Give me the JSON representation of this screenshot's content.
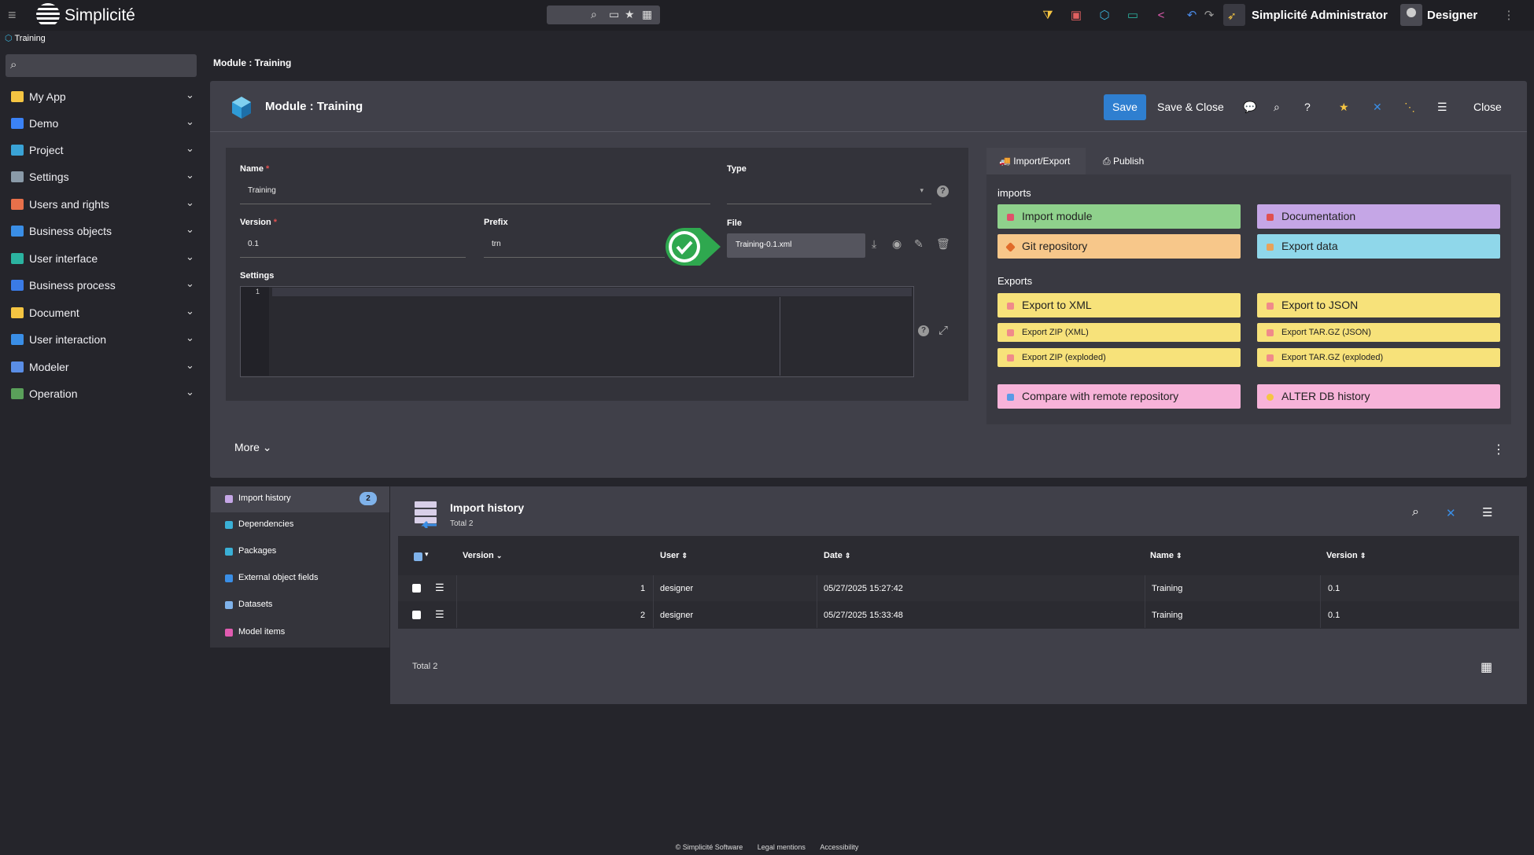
{
  "app": {
    "brand": "Simplicité"
  },
  "topbar": {
    "admin_label": "Simplicité Administrator",
    "user_label": "Designer"
  },
  "breadcrumb": {
    "label": "Training"
  },
  "sidebar": {
    "items": [
      {
        "label": "My App",
        "icon": "folder-icon",
        "color": "#f5c542"
      },
      {
        "label": "Demo",
        "icon": "demo-icon",
        "color": "#3b82f6"
      },
      {
        "label": "Project",
        "icon": "cube-icon",
        "color": "#3aa3d6"
      },
      {
        "label": "Settings",
        "icon": "gear-icon",
        "color": "#8a9aa8"
      },
      {
        "label": "Users and rights",
        "icon": "users-icon",
        "color": "#e8704a"
      },
      {
        "label": "Business objects",
        "icon": "tools-icon",
        "color": "#3a8ee6"
      },
      {
        "label": "User interface",
        "icon": "monitor-icon",
        "color": "#2bb3a0"
      },
      {
        "label": "Business process",
        "icon": "process-icon",
        "color": "#3a7be6"
      },
      {
        "label": "Document",
        "icon": "folder-icon",
        "color": "#f5c542"
      },
      {
        "label": "User interaction",
        "icon": "chat-icon",
        "color": "#3a8ee6"
      },
      {
        "label": "Modeler",
        "icon": "hierarchy-icon",
        "color": "#5a8ee6"
      },
      {
        "label": "Operation",
        "icon": "pulse-icon",
        "color": "#5aa05a"
      }
    ]
  },
  "page": {
    "title": "Module : Training"
  },
  "form": {
    "title": "Module : Training",
    "buttons": {
      "save": "Save",
      "save_close": "Save & Close",
      "close": "Close"
    },
    "fields": {
      "name_label": "Name",
      "name_value": "Training",
      "type_label": "Type",
      "version_label": "Version",
      "version_value": "0.1",
      "prefix_label": "Prefix",
      "prefix_value": "trn",
      "file_label": "File",
      "file_value": "Training-0.1.xml",
      "settings_label": "Settings",
      "editor_line": "1"
    },
    "more_label": "More"
  },
  "tabs": {
    "import_export": "Import/Export",
    "publish": "Publish"
  },
  "actions": {
    "imports_title": "imports",
    "exports_title": "Exports",
    "import_module": "Import module",
    "documentation": "Documentation",
    "git_repository": "Git repository",
    "export_data": "Export data",
    "export_xml": "Export to XML",
    "export_json": "Export to JSON",
    "export_zip_xml": "Export ZIP (XML)",
    "export_targz_json": "Export TAR.GZ (JSON)",
    "export_zip_exploded": "Export ZIP (exploded)",
    "export_targz_exploded": "Export TAR.GZ (exploded)",
    "compare_remote": "Compare with remote repository",
    "alter_db_history": "ALTER DB history",
    "colors": {
      "green": "#8fd18c",
      "purple": "#c5a6e6",
      "orange": "#f7c78a",
      "cyan": "#8fd7ea",
      "yellow": "#f7e27a",
      "pink": "#f7b3d9"
    }
  },
  "bottom_tabs": [
    {
      "label": "Import history",
      "count": "2"
    },
    {
      "label": "Dependencies"
    },
    {
      "label": "Packages"
    },
    {
      "label": "External object fields"
    },
    {
      "label": "Datasets"
    },
    {
      "label": "Model items"
    }
  ],
  "list": {
    "title": "Import history",
    "total_sub": "Total 2",
    "columns": [
      "Version",
      "User",
      "Date",
      "Name",
      "Version"
    ],
    "rows": [
      {
        "num": "1",
        "user": "designer",
        "date": "05/27/2025 15:27:42",
        "name": "Training",
        "version": "0.1"
      },
      {
        "num": "2",
        "user": "designer",
        "date": "05/27/2025 15:33:48",
        "name": "Training",
        "version": "0.1"
      }
    ],
    "footer_total": "Total 2"
  },
  "footer": {
    "copyright": "© Simplicité Software",
    "legal": "Legal mentions",
    "accessibility": "Accessibility"
  }
}
